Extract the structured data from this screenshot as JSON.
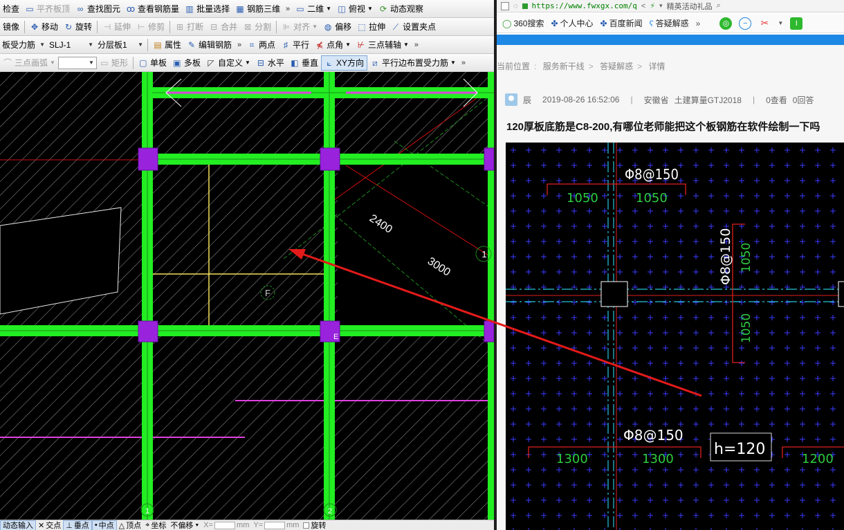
{
  "cad": {
    "toolbar1": [
      {
        "label": "检查",
        "icon": "check-icon",
        "disabled": false
      },
      {
        "label": "平齐板顶",
        "icon": "align-top-icon",
        "disabled": true
      },
      {
        "label": "查找图元",
        "icon": "binoculars-icon",
        "disabled": false
      },
      {
        "label": "查看钢筋量",
        "icon": "rebar-qty-icon",
        "disabled": false
      },
      {
        "label": "批量选择",
        "icon": "batch-select-icon",
        "disabled": false
      },
      {
        "label": "钢筋三维",
        "icon": "rebar-3d-icon",
        "disabled": false
      },
      {
        "label": "二维",
        "icon": "2d-icon",
        "disabled": false
      },
      {
        "label": "俯视",
        "icon": "top-view-icon",
        "disabled": false
      },
      {
        "label": "动态观察",
        "icon": "orbit-icon",
        "disabled": false
      }
    ],
    "toolbar2": [
      {
        "label": "镜像",
        "icon": "",
        "disabled": false
      },
      {
        "label": "移动",
        "icon": "move-icon",
        "disabled": false
      },
      {
        "label": "旋转",
        "icon": "rotate-icon",
        "disabled": false
      },
      {
        "label": "延伸",
        "icon": "extend-icon",
        "disabled": true
      },
      {
        "label": "修剪",
        "icon": "trim-icon",
        "disabled": true
      },
      {
        "label": "打断",
        "icon": "break-icon",
        "disabled": true
      },
      {
        "label": "合并",
        "icon": "merge-icon",
        "disabled": true
      },
      {
        "label": "分割",
        "icon": "split-icon",
        "disabled": true
      },
      {
        "label": "对齐",
        "icon": "align-icon",
        "disabled": true
      },
      {
        "label": "偏移",
        "icon": "offset-icon",
        "disabled": false
      },
      {
        "label": "拉伸",
        "icon": "stretch-icon",
        "disabled": false
      },
      {
        "label": "设置夹点",
        "icon": "grip-icon",
        "disabled": false
      }
    ],
    "toolbar3": {
      "category": "板受力筋",
      "element": "SLJ-1",
      "layer": "分层板1",
      "buttons": [
        {
          "label": "属性",
          "icon": "properties-icon"
        },
        {
          "label": "编辑钢筋",
          "icon": "edit-rebar-icon"
        },
        {
          "label": "两点",
          "icon": "two-point-icon"
        },
        {
          "label": "平行",
          "icon": "parallel-icon"
        },
        {
          "label": "点角",
          "icon": "point-angle-icon"
        },
        {
          "label": "三点辅轴",
          "icon": "three-point-axis-icon"
        }
      ]
    },
    "toolbar4": [
      {
        "label": "三点画弧",
        "icon": "arc-icon",
        "disabled": true
      },
      {
        "label": "矩形",
        "icon": "rectangle-icon",
        "disabled": true
      },
      {
        "label": "单板",
        "icon": "single-slab-icon",
        "disabled": false
      },
      {
        "label": "多板",
        "icon": "multi-slab-icon",
        "disabled": false
      },
      {
        "label": "自定义",
        "icon": "custom-icon",
        "disabled": false
      },
      {
        "label": "水平",
        "icon": "horizontal-icon",
        "disabled": false
      },
      {
        "label": "垂直",
        "icon": "vertical-icon",
        "disabled": false
      },
      {
        "label": "XY方向",
        "icon": "xy-direction-icon",
        "disabled": false
      },
      {
        "label": "平行边布置受力筋",
        "icon": "parallel-edge-icon",
        "disabled": false
      }
    ],
    "drawing": {
      "dim_2400": "2400",
      "dim_3000": "3000",
      "axis_f": "F",
      "axis_1": "1",
      "axis_bottom_1": "1",
      "axis_bottom_2": "2",
      "axis_e": "E"
    },
    "statusbar": [
      {
        "label": "动态输入",
        "pressed": true
      },
      {
        "label": "交点",
        "pressed": false
      },
      {
        "label": "垂点",
        "pressed": true
      },
      {
        "label": "中点",
        "pressed": true
      },
      {
        "label": "顶点",
        "pressed": false
      },
      {
        "label": "坐标",
        "pressed": false
      },
      {
        "label": "不偏移",
        "pressed": false
      },
      {
        "label": "X=",
        "pressed": false
      },
      {
        "label": "mm",
        "pressed": false
      },
      {
        "label": "Y=",
        "pressed": false
      },
      {
        "label": "mm",
        "pressed": false
      },
      {
        "label": "旋转",
        "pressed": false
      }
    ]
  },
  "browser": {
    "url": "https://www.fwxgx.com/q",
    "search_hint": "精英活动礼品",
    "bookmarks": [
      {
        "label": "360搜索",
        "icon": "360-icon"
      },
      {
        "label": "个人中心",
        "icon": "paw-icon"
      },
      {
        "label": "百度新闻",
        "icon": "baidu-paw-icon"
      },
      {
        "label": "答疑解惑",
        "icon": "qa-icon"
      }
    ],
    "breadcrumb": {
      "label": "当前位置",
      "items": [
        "服务新干线",
        "答疑解惑",
        "详情"
      ]
    },
    "post": {
      "author": "辰",
      "datetime": "2019-08-26 16:52:06",
      "region": "安徽省",
      "product": "土建算量GTJ2018",
      "views": "0查看",
      "answers": "0回答",
      "title": "120厚板底筋是C8-200,有哪位老师能把这个板钢筋在软件绘制一下吗"
    },
    "drawing": {
      "rebar_top": "Φ8@150",
      "rebar_side": "Φ8@150",
      "rebar_bottom": "Φ8@150",
      "len_1050_a": "1050",
      "len_1050_b": "1050",
      "len_1050_c": "1050",
      "len_1050_d": "1050",
      "len_1300_a": "1300",
      "len_1300_b": "1300",
      "len_1200": "1200",
      "thickness": "h=120"
    }
  },
  "colors": {
    "cad_beam": "#22ee22",
    "cad_column": "#9922dd",
    "annotation_arrow": "#e31a1a",
    "dwg_rebar_label": "#2ecc40",
    "dwg_axis": "#26c6da",
    "browser_accent": "#1e88e5"
  }
}
